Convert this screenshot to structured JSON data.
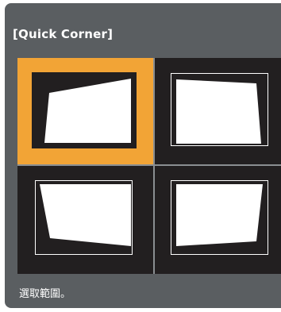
{
  "header": {
    "title": "[Quick Corner]"
  },
  "options": [
    {
      "id": "top-left",
      "selected": true
    },
    {
      "id": "top-right",
      "selected": false
    },
    {
      "id": "bottom-left",
      "selected": false
    },
    {
      "id": "bottom-right",
      "selected": false
    }
  ],
  "footer": {
    "hint": "選取範圍。"
  },
  "colors": {
    "panel": "#5a5e61",
    "cell": "#221f20",
    "selected": "#f2a436",
    "screen": "#ffffff",
    "divider": "#8a8e91"
  }
}
